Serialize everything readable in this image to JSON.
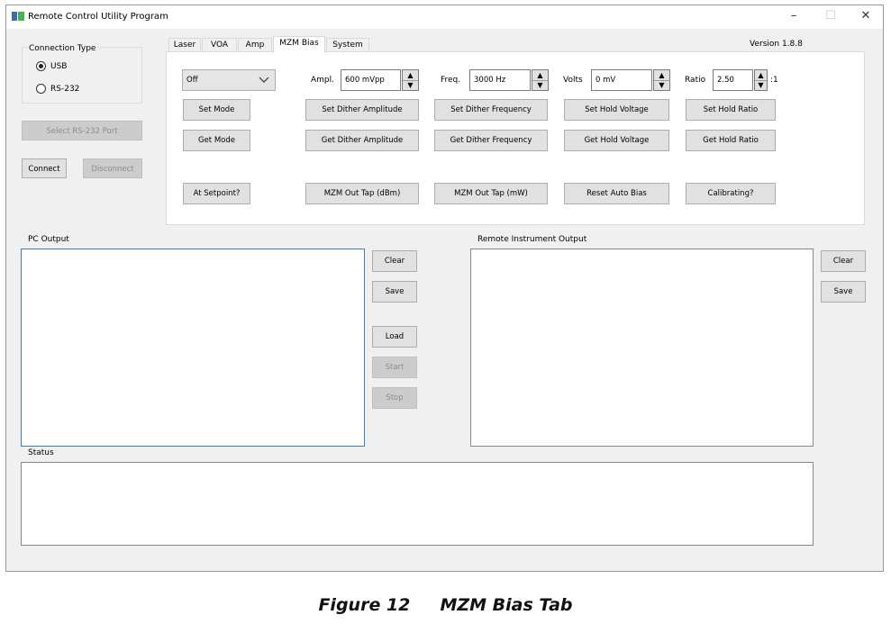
{
  "window": {
    "title": "Remote Control Utility Program",
    "controls": {
      "minimize": "–",
      "maximize": "☐",
      "close": "✕"
    }
  },
  "connection": {
    "group_label": "Connection Type",
    "usb_label": "USB",
    "rs232_label": "RS-232",
    "selected": "USB",
    "select_port_label": "Select RS-232 Port",
    "connect_label": "Connect",
    "disconnect_label": "Disconnect"
  },
  "tabs": {
    "items": [
      "Laser",
      "VOA",
      "Amp",
      "MZM Bias",
      "System"
    ],
    "active": "MZM Bias",
    "version": "Version 1.8.8"
  },
  "mzm": {
    "mode_value": "Off",
    "ampl_label": "Ampl.",
    "ampl_value": "600 mVpp",
    "freq_label": "Freq.",
    "freq_value": "3000 Hz",
    "volts_label": "Volts",
    "volts_value": "0 mV",
    "ratio_label": "Ratio",
    "ratio_value": "2.50",
    "ratio_suffix": ":1",
    "buttons": {
      "set_mode": "Set Mode",
      "get_mode": "Get Mode",
      "at_setpoint": "At Setpoint?",
      "set_dither_amp": "Set Dither Amplitude",
      "get_dither_amp": "Get Dither Amplitude",
      "out_tap_dbm": "MZM Out Tap (dBm)",
      "set_dither_freq": "Set Dither Frequency",
      "get_dither_freq": "Get Dither Frequency",
      "out_tap_mw": "MZM Out Tap (mW)",
      "set_hold_voltage": "Set Hold Voltage",
      "get_hold_voltage": "Get Hold Voltage",
      "reset_auto_bias": "Reset Auto Bias",
      "set_hold_ratio": "Set Hold Ratio",
      "get_hold_ratio": "Get Hold Ratio",
      "calibrating": "Calibrating?"
    }
  },
  "pc_output": {
    "label": "PC Output",
    "clear": "Clear",
    "save": "Save",
    "load": "Load",
    "start": "Start",
    "stop": "Stop"
  },
  "remote_output": {
    "label": "Remote Instrument Output",
    "clear": "Clear",
    "save": "Save"
  },
  "status": {
    "label": "Status"
  },
  "caption": "Figure 12     MZM Bias Tab"
}
